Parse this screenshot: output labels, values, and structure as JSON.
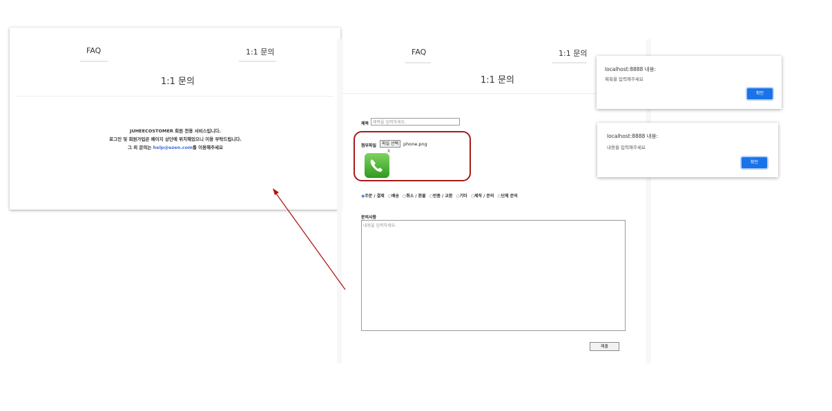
{
  "left_panel": {
    "tabs": [
      {
        "label": "FAQ"
      },
      {
        "label": "1:1 문의"
      }
    ],
    "title": "1:1 문의",
    "notice_line1": "JUHEECOSTOMER 회원 전용 서비스입니다.",
    "notice_line2": "로그인 및 회원가입은 페이지 상단에 위치해있으니 이용 부탁드립니다.",
    "notice_line3_prefix": "그 외 문의는 ",
    "notice_email": "help@ezen.com",
    "notice_line3_suffix": "를 이용해주세요"
  },
  "form_panel": {
    "tabs": [
      {
        "label": "FAQ"
      },
      {
        "label": "1:1 문의"
      }
    ],
    "title": "1:1 문의",
    "subject_label": "제목",
    "subject_placeholder": "제목을 입력하세요.",
    "attachment_label": "첨부파일",
    "file_button_label": "파일 선택",
    "file_name": "phone.png",
    "thumbnail_remove_label": "X",
    "thumbnail_icon": "phone-icon",
    "categories": [
      {
        "label": "주문 / 결제",
        "selected": true
      },
      {
        "label": "배송",
        "selected": false
      },
      {
        "label": "취소 / 환불",
        "selected": false
      },
      {
        "label": "반품 / 교환",
        "selected": false
      },
      {
        "label": "기타",
        "selected": false
      },
      {
        "label": "제작 / 문의",
        "selected": false
      },
      {
        "label": "단체 문의",
        "selected": false
      }
    ],
    "content_label": "문의사항",
    "content_placeholder": "내용을 입력하세요.",
    "submit_label": "제출",
    "highlight_color": "#a41a1a"
  },
  "dialogs": [
    {
      "host": "localhost:8888 내용:",
      "message": "제목을 입력해주세요",
      "ok_label": "확인"
    },
    {
      "host": "localhost:8888 내용:",
      "message": "내용을 입력해주세요",
      "ok_label": "확인"
    }
  ],
  "colors": {
    "accent": "#1a73e8",
    "link": "#3b6ee3",
    "arrow": "#b01818"
  }
}
